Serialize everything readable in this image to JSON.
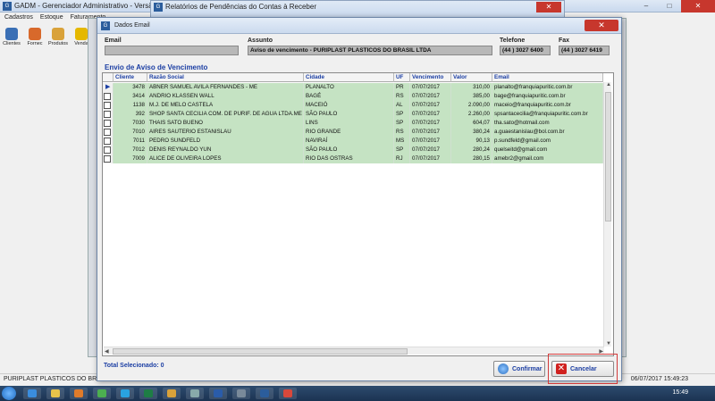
{
  "app": {
    "title": "GADM - Gerenciador Administrativo - Versão: 3.2",
    "icon": "app-icon",
    "menu": [
      "Cadastros",
      "Estoque",
      "Faturamento"
    ],
    "toolbar": [
      {
        "label": "Clientes",
        "icon": "clients-icon",
        "color": "#3a6fb5"
      },
      {
        "label": "Fornec",
        "icon": "supplier-icon",
        "color": "#d8692b"
      },
      {
        "label": "Produtos",
        "icon": "products-icon",
        "color": "#d9a23a"
      },
      {
        "label": "Venda",
        "icon": "sale-icon",
        "color": "#e5b800"
      }
    ],
    "status_company": "PURIPLAST PLASTICOS DO BRASIL",
    "status_datetime": "06/07/2017 15:49:23"
  },
  "report_window": {
    "title": "Relatórios de Pendências do Contas à Receber"
  },
  "dialog": {
    "title": "Dados Email",
    "close_glyph": "✕",
    "fields": {
      "email_label": "Email",
      "email_value": "",
      "subject_label": "Assunto",
      "subject_value": "Aviso de vencimento - PURIPLAST PLASTICOS DO BRASIL LTDA",
      "phone_label": "Telefone",
      "phone_value": "(44 ) 3027 6400",
      "fax_label": "Fax",
      "fax_value": "(44 ) 3027 6419"
    },
    "section_title": "Envio de Aviso de Vencimento",
    "columns": [
      "Cliente",
      "Razão Social",
      "Cidade",
      "UF",
      "Vencimento",
      "Valor",
      "Email"
    ],
    "rows": [
      {
        "cliente": "3478",
        "razao": "ABNER SAMUEL AVILA FERNANDES - ME",
        "cidade": "PLANALTO",
        "uf": "PR",
        "vencimento": "07/07/2017",
        "valor": "310,00",
        "email": "planalto@franquiapuritic.com.br",
        "current": true
      },
      {
        "cliente": "3414",
        "razao": "ANDRIO KLASSEN WALL",
        "cidade": "BAGÉ",
        "uf": "RS",
        "vencimento": "07/07/2017",
        "valor": "385,00",
        "email": "bage@franquiapuritic.com.br",
        "current": false
      },
      {
        "cliente": "1138",
        "razao": "M.J. DE MELO CASTELA",
        "cidade": "MACEIÓ",
        "uf": "AL",
        "vencimento": "07/07/2017",
        "valor": "2.090,00",
        "email": "maceio@franquiapuritic.com.br",
        "current": false
      },
      {
        "cliente": "392",
        "razao": "SHOP SANTA CECILIA COM. DE PURIF. DE AGUA LTDA.ME",
        "cidade": "SÃO PAULO",
        "uf": "SP",
        "vencimento": "07/07/2017",
        "valor": "2.260,00",
        "email": "spsantacecilia@franquiapuritic.com.br",
        "current": false
      },
      {
        "cliente": "7030",
        "razao": "THAIS SATO BUENO",
        "cidade": "LINS",
        "uf": "SP",
        "vencimento": "07/07/2017",
        "valor": "604,07",
        "email": "tha.sato@hotmail.com",
        "current": false
      },
      {
        "cliente": "7010",
        "razao": "AIRES SAUTERIO ESTANISLAU",
        "cidade": "RIO GRANDE",
        "uf": "RS",
        "vencimento": "07/07/2017",
        "valor": "380,24",
        "email": "a.guaestanislau@bol.com.br",
        "current": false
      },
      {
        "cliente": "7011",
        "razao": "PEDRO SUNDFELD",
        "cidade": "NAVIRAÍ",
        "uf": "MS",
        "vencimento": "07/07/2017",
        "valor": "90,13",
        "email": "p.sundfeld@gmail.com",
        "current": false
      },
      {
        "cliente": "7012",
        "razao": "DENIS REYNALDO YUN",
        "cidade": "SÃO PAULO",
        "uf": "SP",
        "vencimento": "07/07/2017",
        "valor": "280,24",
        "email": "quelseitd@gmail.com",
        "current": false
      },
      {
        "cliente": "7009",
        "razao": "ALICE DE OLIVEIRA LOPES",
        "cidade": "RIO DAS OSTRAS",
        "uf": "RJ",
        "vencimento": "07/07/2017",
        "valor": "280,15",
        "email": "amebr2@gmail.com",
        "current": false
      }
    ],
    "total_label": "Total Selecionado: 0",
    "confirm_label": "Confirmar",
    "cancel_label": "Cancelar",
    "colors": {
      "row_bg": "#c5e3c3",
      "accent": "#1b3ea3",
      "highlight": "#d23a3a"
    }
  },
  "taskbar": {
    "time": "15:49",
    "apps": [
      {
        "icon": "ie-icon",
        "color": "#3a8dde"
      },
      {
        "icon": "folder-icon",
        "color": "#e8c34a"
      },
      {
        "icon": "media-icon",
        "color": "#e07b2a"
      },
      {
        "icon": "chrome-icon",
        "color": "#4caf50"
      },
      {
        "icon": "skype-icon",
        "color": "#29a3e0"
      },
      {
        "icon": "excel-icon",
        "color": "#1e7d45"
      },
      {
        "icon": "explorer-icon",
        "color": "#d9a23a"
      },
      {
        "icon": "people-icon",
        "color": "#8aa"
      },
      {
        "icon": "word-icon",
        "color": "#2a5caa"
      },
      {
        "icon": "files-icon",
        "color": "#7a8a9a"
      },
      {
        "icon": "gadm-icon",
        "color": "#2b5d9c"
      },
      {
        "icon": "chrome-icon-2",
        "color": "#d9483b"
      }
    ]
  }
}
